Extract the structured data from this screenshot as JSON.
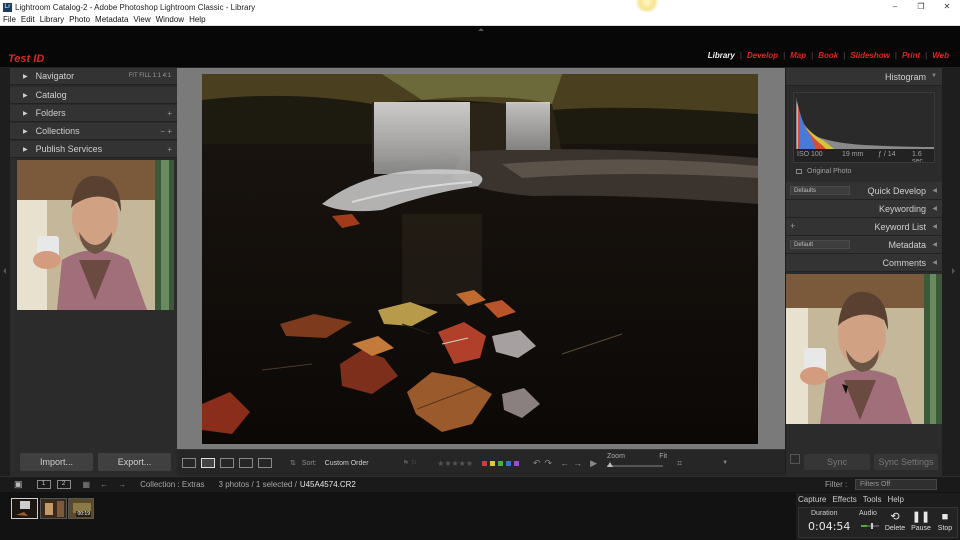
{
  "window": {
    "title": "Lightroom Catalog-2 - Adobe Photoshop Lightroom Classic - Library",
    "app_icon": "Lr",
    "controls": [
      "–",
      "❐",
      "✕"
    ]
  },
  "menu": [
    "File",
    "Edit",
    "Library",
    "Photo",
    "Metadata",
    "View",
    "Window",
    "Help"
  ],
  "identity_plate": "Test ID",
  "modules": [
    {
      "label": "Library",
      "active": true
    },
    {
      "label": "Develop",
      "active": false
    },
    {
      "label": "Map",
      "active": false
    },
    {
      "label": "Book",
      "active": false
    },
    {
      "label": "Slideshow",
      "active": false
    },
    {
      "label": "Print",
      "active": false
    },
    {
      "label": "Web",
      "active": false
    }
  ],
  "left_panel": {
    "navigator": {
      "label": "Navigator",
      "zoom": "FIT   FILL   1:1   4:1"
    },
    "sections": [
      {
        "label": "Catalog",
        "extra": ""
      },
      {
        "label": "Folders",
        "extra": "+"
      },
      {
        "label": "Collections",
        "extra": "−  +"
      },
      {
        "label": "Publish Services",
        "extra": "+"
      }
    ],
    "import_label": "Import...",
    "export_label": "Export..."
  },
  "toolbar": {
    "sort_label": "Sort:",
    "sort_value": "Custom Order",
    "sort_icon": "sort-az-icon",
    "stars": "★★★★★",
    "color_labels": [
      "#d23b3b",
      "#e3c53c",
      "#4fae3e",
      "#3a6fd8",
      "#9b4fd0"
    ],
    "zoom_label": "Zoom",
    "zoom_value": "Fit"
  },
  "right_panel": {
    "histogram": {
      "label": "Histogram",
      "iso": "ISO 100",
      "focal": "19 mm",
      "aperture": "ƒ / 14",
      "shutter": "1.6 sec",
      "original": "Original Photo"
    },
    "quick_develop": {
      "label": "Quick Develop",
      "preset": "Defaults"
    },
    "keywording": "Keywording",
    "keyword_list": "Keyword List",
    "metadata": {
      "label": "Metadata",
      "preset": "Default"
    },
    "comments": "Comments",
    "sync_label": "Sync",
    "sync_settings_label": "Sync Settings"
  },
  "filmbar": {
    "pages": [
      "1",
      "2"
    ],
    "source": "Collection : Extras",
    "count": "3 photos / 1 selected /",
    "filename": "U45A4574.CR2",
    "filter_label": "Filter :",
    "filter_value": "Filters Off"
  },
  "filmstrip": {
    "video_duration": "00:19"
  },
  "capture": {
    "menu": [
      "Capture",
      "Effects",
      "Tools",
      "Help"
    ],
    "duration_label": "Duration",
    "duration": "0:04:54",
    "audio_label": "Audio",
    "delete_label": "Delete",
    "pause_label": "Pause",
    "stop_label": "Stop"
  }
}
